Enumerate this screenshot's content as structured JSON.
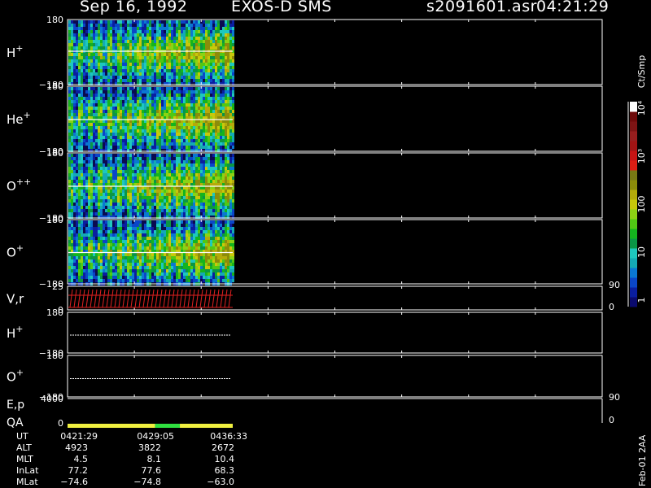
{
  "header": {
    "date": "Sep 16, 1992",
    "mission": "EXOS-D SMS",
    "file": "s2091601.asr",
    "time": "04:21:29"
  },
  "colorbar": {
    "unit_label": "Ct/Smp",
    "tick_labels": [
      "1",
      "10",
      "100",
      "10³",
      "10⁴"
    ],
    "colors": [
      "#0a0a6e",
      "#0a1ea0",
      "#0a46c8",
      "#0a78d2",
      "#14aab4",
      "#1ec8be",
      "#0a9646",
      "#14b41e",
      "#50c814",
      "#8cd214",
      "#c8c80a",
      "#b4aa0a",
      "#8c8c0a",
      "#787814",
      "#dc1e14",
      "#c81414",
      "#a01414",
      "#961e1e",
      "#7d1414",
      "#6e0a0a",
      "#ffffff"
    ]
  },
  "chart_data": [
    {
      "type": "heatmap",
      "panel": "H+",
      "label": "H",
      "sup": "+",
      "ylim": [
        -180,
        180
      ],
      "tick_labels": [
        "180",
        "−180"
      ]
    },
    {
      "type": "heatmap",
      "panel": "He+",
      "label": "He",
      "sup": "+",
      "ylim": [
        -180,
        180
      ],
      "tick_labels": [
        "180",
        "−180"
      ]
    },
    {
      "type": "heatmap",
      "panel": "O++",
      "label": "O",
      "sup": "++",
      "ylim": [
        -180,
        180
      ],
      "tick_labels": [
        "180",
        "−180"
      ]
    },
    {
      "type": "heatmap",
      "panel": "O+",
      "label": "O",
      "sup": "+",
      "ylim": [
        -180,
        180
      ],
      "tick_labels": [
        "180",
        "−180"
      ]
    },
    {
      "type": "line",
      "panel": "V,r",
      "label": "V,r",
      "left_ticks": [
        "25",
        "0"
      ],
      "right_ticks": [
        "90",
        "0"
      ],
      "color": "#e02020"
    },
    {
      "type": "line",
      "panel": "H+ angle",
      "label": "H",
      "sup": "+",
      "ylim": [
        -180,
        180
      ],
      "tick_labels": [
        "180",
        "−180"
      ],
      "trace_value": 0
    },
    {
      "type": "line",
      "panel": "O+ angle",
      "label": "O",
      "sup": "+",
      "ylim": [
        -180,
        180
      ],
      "tick_labels": [
        "180",
        "−180"
      ],
      "trace_value": 0
    },
    {
      "type": "line",
      "panel": "E,p",
      "label": "E,p",
      "left_ticks": [
        "4000",
        "0"
      ],
      "right_ticks": [
        "90",
        "0"
      ]
    },
    {
      "type": "bar",
      "panel": "QA",
      "label": "QA",
      "segments": [
        {
          "color": "#f0f040",
          "fraction": 0.53
        },
        {
          "color": "#30e040",
          "fraction": 0.15
        },
        {
          "color": "#f0f040",
          "fraction": 0.32
        }
      ]
    }
  ],
  "footer": {
    "rows": [
      {
        "label": "UT",
        "values": [
          "0421:29",
          "0429:05",
          "0436:33"
        ]
      },
      {
        "label": "ALT",
        "values": [
          "4923",
          "3822",
          "2672"
        ]
      },
      {
        "label": "MLT",
        "values": [
          "4.5",
          "8.1",
          "10.4"
        ]
      },
      {
        "label": "InLat",
        "values": [
          "77.2",
          "77.6",
          "68.3"
        ]
      },
      {
        "label": "MLat",
        "values": [
          "−74.6",
          "−74.8",
          "−63.0"
        ]
      }
    ],
    "side_note": "Feb-01  2AA"
  }
}
